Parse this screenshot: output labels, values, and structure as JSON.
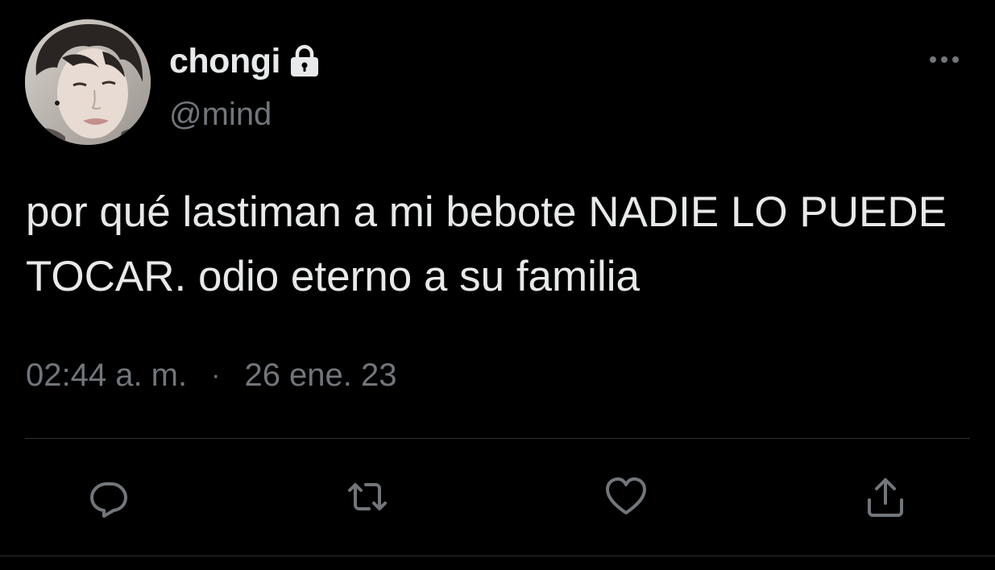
{
  "user": {
    "display_name": "chongi",
    "handle": "@mind",
    "protected_icon": "lock-icon"
  },
  "tweet": {
    "text": "por qué lastiman a mi bebote NADIE LO PUEDE TOCAR. odio eterno a su familia",
    "time": "02:44 a. m.",
    "separator": "·",
    "date": "26 ene. 23"
  },
  "actions": {
    "reply_icon": "reply-icon",
    "retweet_icon": "retweet-icon",
    "like_icon": "heart-icon",
    "share_icon": "share-icon"
  },
  "menu_icon": "more-icon",
  "colors": {
    "background": "#000000",
    "text": "#e7e9ea",
    "secondary_text": "#71767b",
    "divider": "#2f3336"
  }
}
